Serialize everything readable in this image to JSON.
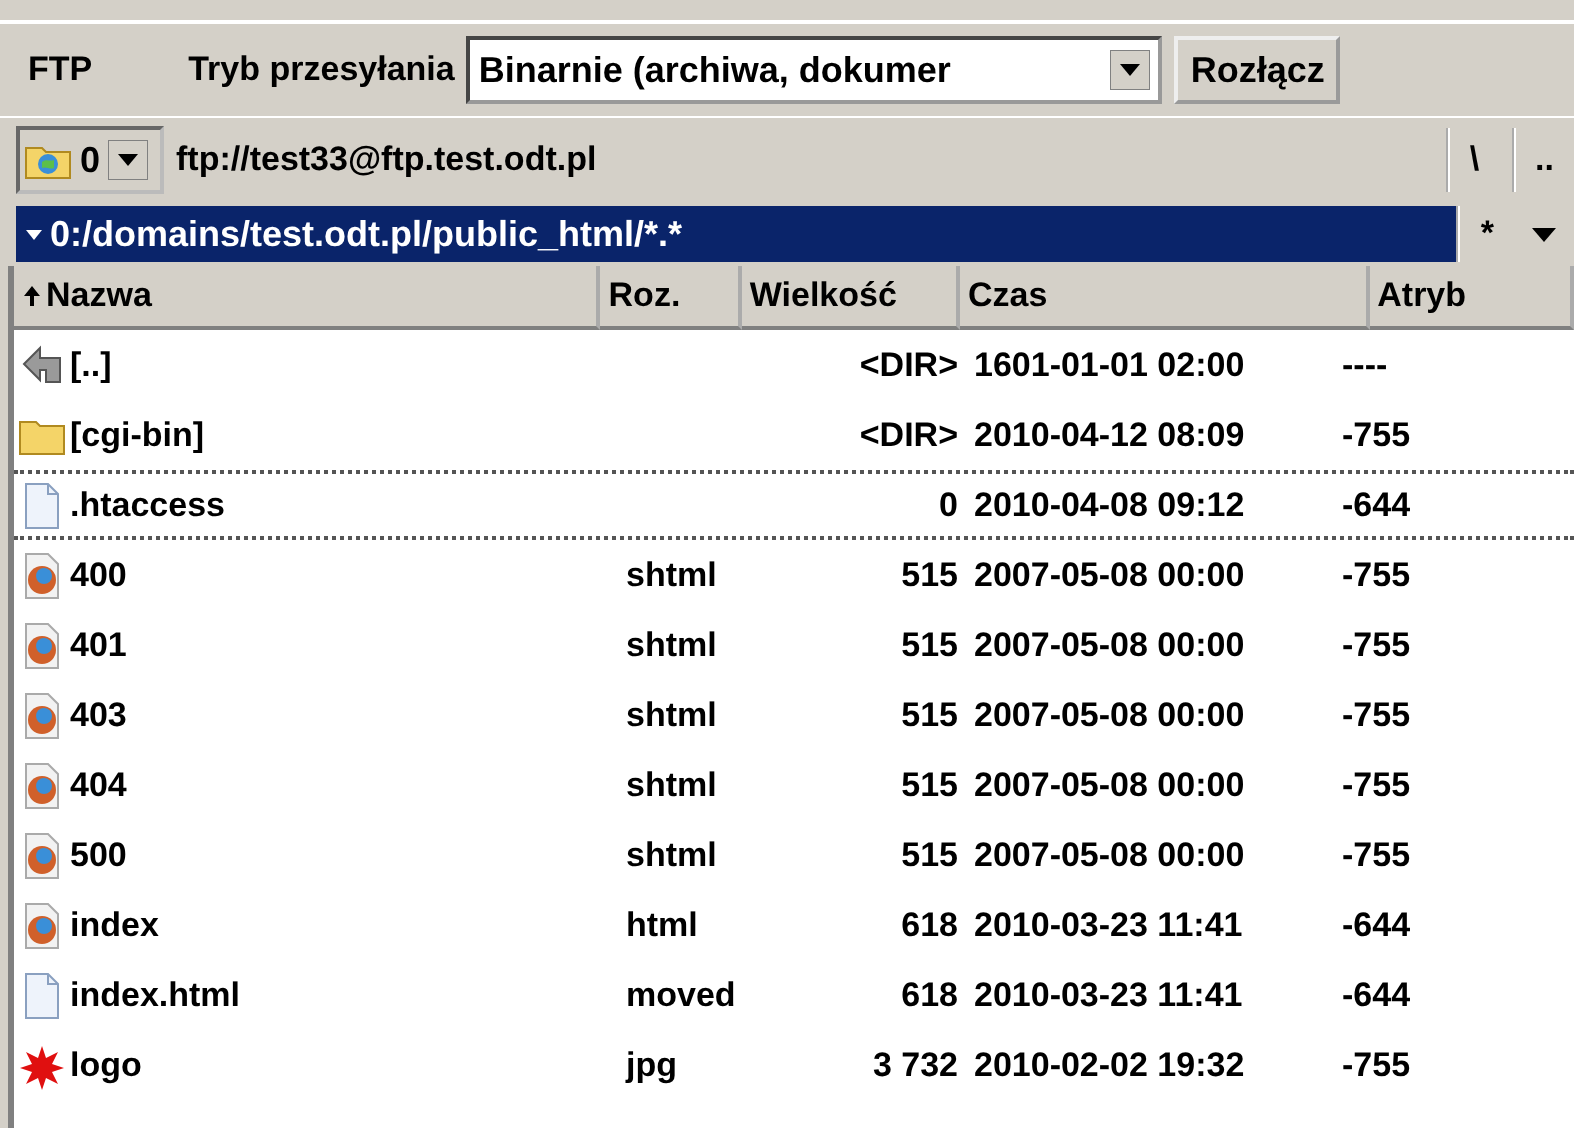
{
  "toolbar": {
    "label_ftp": "FTP",
    "label_mode": "Tryb przesyłania",
    "mode_value": "Binarnie (archiwa, dokumer",
    "disconnect": "Rozłącz"
  },
  "drive": {
    "label": "0",
    "address": "ftp://test33@ftp.test.odt.pl",
    "root_button": "\\",
    "up_button": ".."
  },
  "path": {
    "text": "0:/domains/test.odt.pl/public_html/*.*",
    "filter_button": "*"
  },
  "table": {
    "columns": [
      {
        "label": "Nazwa",
        "sorted": true
      },
      {
        "label": "Roz.",
        "sorted": false
      },
      {
        "label": "Wielkość",
        "sorted": false
      },
      {
        "label": "Czas",
        "sorted": false
      },
      {
        "label": "Atryb",
        "sorted": false
      }
    ],
    "rows": [
      {
        "kind": "up",
        "name": "[..]",
        "ext": "",
        "size": "<DIR>",
        "time": "1601-01-01 02:00",
        "attr": "----",
        "focused": false
      },
      {
        "kind": "folder",
        "name": "[cgi-bin]",
        "ext": "",
        "size": "<DIR>",
        "time": "2010-04-12 08:09",
        "attr": "-755",
        "focused": false
      },
      {
        "kind": "file",
        "name": ".htaccess",
        "ext": "",
        "size": "0",
        "time": "2010-04-08 09:12",
        "attr": "-644",
        "focused": true
      },
      {
        "kind": "web",
        "name": "400",
        "ext": "shtml",
        "size": "515",
        "time": "2007-05-08 00:00",
        "attr": "-755",
        "focused": false
      },
      {
        "kind": "web",
        "name": "401",
        "ext": "shtml",
        "size": "515",
        "time": "2007-05-08 00:00",
        "attr": "-755",
        "focused": false
      },
      {
        "kind": "web",
        "name": "403",
        "ext": "shtml",
        "size": "515",
        "time": "2007-05-08 00:00",
        "attr": "-755",
        "focused": false
      },
      {
        "kind": "web",
        "name": "404",
        "ext": "shtml",
        "size": "515",
        "time": "2007-05-08 00:00",
        "attr": "-755",
        "focused": false
      },
      {
        "kind": "web",
        "name": "500",
        "ext": "shtml",
        "size": "515",
        "time": "2007-05-08 00:00",
        "attr": "-755",
        "focused": false
      },
      {
        "kind": "web",
        "name": "index",
        "ext": "html",
        "size": "618",
        "time": "2010-03-23 11:41",
        "attr": "-644",
        "focused": false
      },
      {
        "kind": "file",
        "name": "index.html",
        "ext": "moved",
        "size": "618",
        "time": "2010-03-23 11:41",
        "attr": "-644",
        "focused": false
      },
      {
        "kind": "image",
        "name": "logo",
        "ext": "jpg",
        "size": "3 732",
        "time": "2010-02-02 19:32",
        "attr": "-755",
        "focused": false
      }
    ]
  }
}
